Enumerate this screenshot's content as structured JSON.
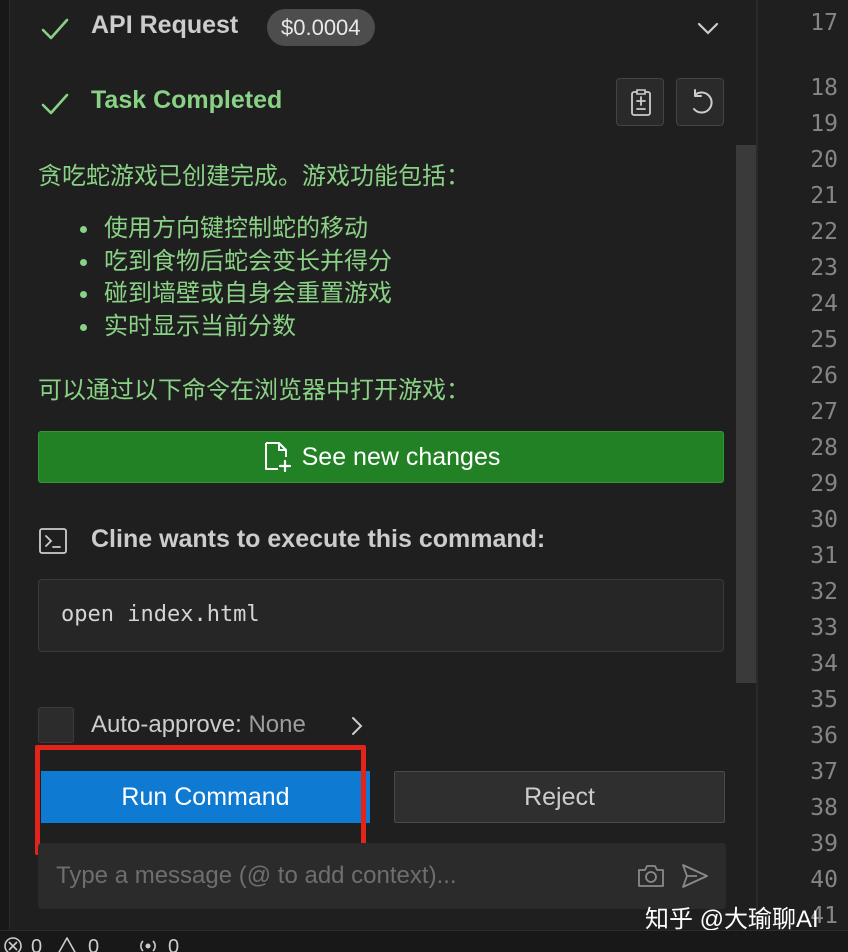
{
  "api_request": {
    "title": "API Request",
    "cost": "$0.0004",
    "icons": [
      "check-icon",
      "chevron-down-icon"
    ]
  },
  "task": {
    "title": "Task Completed",
    "summary": "贪吃蛇游戏已创建完成。游戏功能包括：",
    "features": [
      "使用方向键控制蛇的移动",
      "吃到食物后蛇会变长并得分",
      "碰到墙壁或自身会重置游戏",
      "实时显示当前分数"
    ],
    "open_hint": "可以通过以下命令在浏览器中打开游戏：",
    "icons": [
      "check-icon",
      "copy-icon",
      "undo-icon"
    ]
  },
  "see_changes": {
    "label": "See new changes",
    "icon": "file-diff-icon"
  },
  "command": {
    "heading": "Cline wants to execute this command:",
    "text": "open index.html",
    "icon": "terminal-icon"
  },
  "auto_approve": {
    "label": "Auto-approve:",
    "value": "None"
  },
  "actions": {
    "run": "Run Command",
    "reject": "Reject"
  },
  "message": {
    "placeholder": "Type a message (@ to add context)..."
  },
  "line_numbers": [
    "17",
    "18",
    "19",
    "20",
    "21",
    "22",
    "23",
    "24",
    "25",
    "26",
    "27",
    "28",
    "29",
    "30",
    "31",
    "32",
    "33",
    "34",
    "35",
    "36",
    "37",
    "38",
    "39",
    "40",
    "41"
  ],
  "status_bar": {
    "errors": "0",
    "warnings": "0",
    "ports": "0"
  },
  "watermark": "知乎 @大瑜聊AI",
  "colors": {
    "success_green": "#89d185",
    "primary_button": "#0e7ad1",
    "changes_button": "#228125",
    "highlight_red": "#e2241b"
  }
}
